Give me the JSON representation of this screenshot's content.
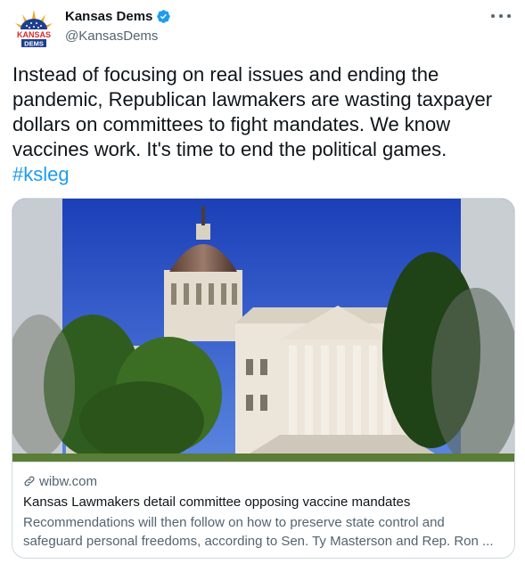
{
  "author": {
    "display_name": "Kansas Dems",
    "handle": "@KansasDems",
    "avatar_text_top": "KANSAS",
    "avatar_text_bottom": "DEMS",
    "verified": true
  },
  "tweet": {
    "text": "Instead of focusing on real issues and ending the pandemic, Republican lawmakers are wasting taxpayer dollars on committees to fight mandates. We know vaccines work. It's time to end the political games.",
    "hashtag": "#ksleg"
  },
  "card": {
    "domain": "wibw.com",
    "title": "Kansas Lawmakers detail committee opposing vaccine mandates",
    "description": "Recommendations will then follow on how to preserve state control and safeguard personal freedoms, according to Sen. Ty Masterson and Rep. Ron ..."
  },
  "icons": {
    "verified": "verified-badge-icon",
    "more": "more-options-icon",
    "link": "link-icon"
  },
  "colors": {
    "accent": "#1d9bf0",
    "secondary_text": "#536471",
    "border": "#cfd9de"
  }
}
